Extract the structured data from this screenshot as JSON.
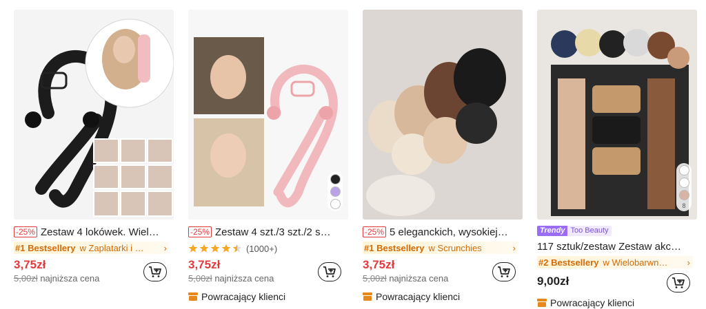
{
  "products": [
    {
      "discount": "-25%",
      "title": "Zestaw 4 lokówek. Wiel…",
      "bestseller_tag": "#1 Bestsellery",
      "bestseller_category": "w Zaplatarki i …",
      "price": "3,75zł",
      "old_price": "5,00zł",
      "lowest_price_label": "najniższa cena"
    },
    {
      "discount": "-25%",
      "title": "Zestaw 4 szt./3 szt./2 s…",
      "rating_value": 4.5,
      "rating_count": "(1000+)",
      "price": "3,75zł",
      "old_price": "5,00zł",
      "lowest_price_label": "najniższa cena",
      "returning_label": "Powracający klienci",
      "swatch_colors": [
        "#222222",
        "#b9a3e6",
        "#ffffff"
      ]
    },
    {
      "discount": "-25%",
      "title": "5 eleganckich, wysokiej…",
      "bestseller_tag": "#1 Bestsellery",
      "bestseller_category": "w Scrunchies",
      "price": "3,75zł",
      "old_price": "5,00zł",
      "lowest_price_label": "najniższa cena",
      "returning_label": "Powracający klienci"
    },
    {
      "trendy_label": "Trendy",
      "brand_label": "Too Beauty",
      "title": "117 sztuk/zestaw Zestaw akc…",
      "bestseller_tag": "#2 Bestsellery",
      "bestseller_category": "w Wielobarwn…",
      "price": "9,00zł",
      "returning_label": "Powracający klienci",
      "swatch_colors": [
        "#ffffff",
        "#ffffff",
        "#d9b3a6"
      ],
      "swatch_count": "8"
    }
  ],
  "icons": {
    "cart": "add-to-cart-icon",
    "chevron": "chevron-right-icon",
    "returning": "box-icon",
    "star": "star-icon"
  },
  "colors": {
    "price": "#e4393c",
    "bestseller": "#d46b08",
    "trendy": "#9b6cf5",
    "star": "#f5a623"
  }
}
